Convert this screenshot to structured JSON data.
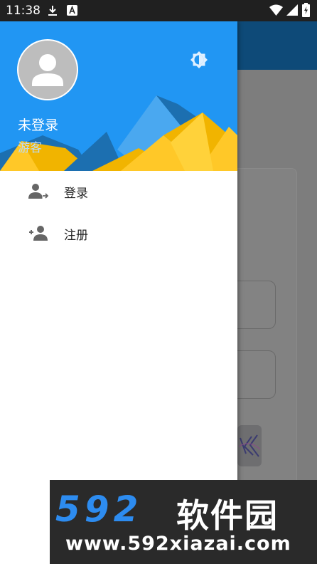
{
  "status_bar": {
    "time": "11:38",
    "icons": [
      "download-icon",
      "a-notification-icon",
      "wifi-icon",
      "signal-icon",
      "battery-icon"
    ]
  },
  "drawer": {
    "header": {
      "name": "未登录",
      "subtitle": "游客",
      "background_color": "#2196f3",
      "avatar_icon": "person-icon",
      "theme_icon": "brightness-icon"
    },
    "menu": [
      {
        "label": "登录",
        "icon": "login-icon"
      },
      {
        "label": "注册",
        "icon": "add-user-icon"
      }
    ]
  },
  "watermark": {
    "brand_digits": "592",
    "brand_text": "软件园",
    "url": "www.592xiazai.com"
  }
}
